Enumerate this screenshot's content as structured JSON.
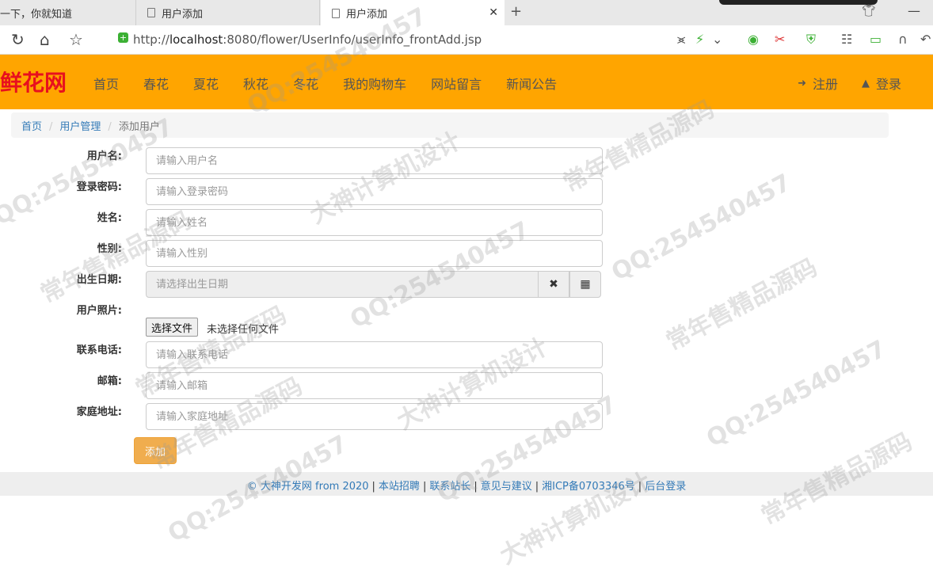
{
  "browser": {
    "tabs": [
      {
        "label": "一下，你就知道"
      },
      {
        "label": "用户添加"
      },
      {
        "label": "用户添加"
      }
    ],
    "close_tab": "✕",
    "new_tab": "+",
    "url_prefix": "http://",
    "url_host": "localhost",
    "url_rest": ":8080/flower/UserInfo/userInfo_frontAdd.jsp"
  },
  "site": {
    "logo": "鲜花网",
    "menu": [
      "首页",
      "春花",
      "夏花",
      "秋花",
      "冬花",
      "我的购物车",
      "网站留言",
      "新闻公告"
    ],
    "register": "注册",
    "login": "登录"
  },
  "breadcrumb": {
    "home": "首页",
    "section": "用户管理",
    "current": "添加用户"
  },
  "form": {
    "username": {
      "label": "用户名:",
      "placeholder": "请输入用户名"
    },
    "password": {
      "label": "登录密码:",
      "placeholder": "请输入登录密码"
    },
    "name": {
      "label": "姓名:",
      "placeholder": "请输入姓名"
    },
    "gender": {
      "label": "性别:",
      "placeholder": "请输入性别"
    },
    "birthday": {
      "label": "出生日期:",
      "placeholder": "请选择出生日期"
    },
    "photo": {
      "label": "用户照片:",
      "button": "选择文件",
      "status": "未选择任何文件"
    },
    "phone": {
      "label": "联系电话:",
      "placeholder": "请输入联系电话"
    },
    "email": {
      "label": "邮箱:",
      "placeholder": "请输入邮箱"
    },
    "address": {
      "label": "家庭地址:",
      "placeholder": "请输入家庭地址"
    },
    "submit": "添加"
  },
  "footer": {
    "copyright": "© 大神开发网 from 2020",
    "links": [
      "本站招聘",
      "联系站长",
      "意见与建议",
      "湘ICP备0703346号",
      "后台登录"
    ]
  },
  "watermarks": [
    "QQ:254540457",
    "常年售精品源码",
    "大神计算机设计"
  ],
  "colors": {
    "header": "#ffa500",
    "logo": "#e8101e",
    "link": "#337ab7",
    "submit": "#f0ad4e"
  }
}
